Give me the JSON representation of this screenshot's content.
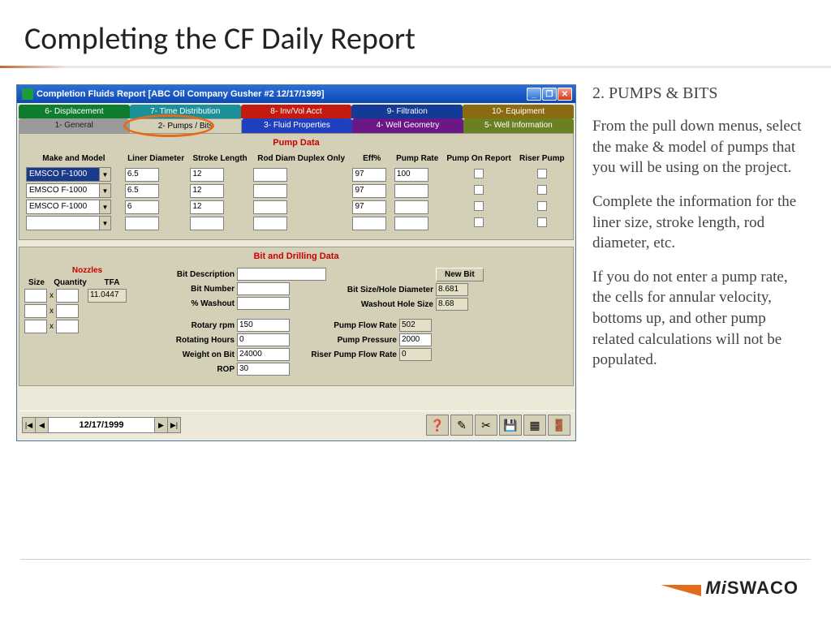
{
  "slide": {
    "title": "Completing the CF Daily Report"
  },
  "sidebar_text": {
    "heading": "2. PUMPS & BITS",
    "p1": "From the pull down menus, select the make & model of pumps that you will be using on the project.",
    "p2": "Complete the information for the liner size, stroke length, rod diameter, etc.",
    "p3": "If you do not enter a pump rate, the cells for annular velocity, bottoms up, and other pump related calculations will not be populated."
  },
  "window": {
    "title": "Completion Fluids Report [ABC Oil Company  Gusher #2  12/17/1999]",
    "tabs_top": [
      "6- Displacement",
      "7- Time Distribution",
      "8- Inv/Vol Acct",
      "9- Filtration",
      "10- Equipment"
    ],
    "tabs_bottom": [
      "1- General",
      "2- Pumps / Bits",
      "3- Fluid Properties",
      "4- Well Geometry",
      "5- Well Information"
    ],
    "active_tab": "2- Pumps / Bits",
    "pump_section_title": "Pump Data",
    "pump_headers": {
      "make": "Make and Model",
      "liner": "Liner Diameter",
      "stroke": "Stroke Length",
      "rod": "Rod Diam Duplex Only",
      "eff": "Eff%",
      "rate": "Pump Rate",
      "onreport": "Pump On Report",
      "riser": "Riser Pump"
    },
    "pump_rows": [
      {
        "make": "EMSCO F-1000",
        "liner": "6.5",
        "stroke": "12",
        "rod": "",
        "eff": "97",
        "rate": "100"
      },
      {
        "make": "EMSCO F-1000",
        "liner": "6.5",
        "stroke": "12",
        "rod": "",
        "eff": "97",
        "rate": ""
      },
      {
        "make": "EMSCO F-1000",
        "liner": "6",
        "stroke": "12",
        "rod": "",
        "eff": "97",
        "rate": ""
      },
      {
        "make": "",
        "liner": "",
        "stroke": "",
        "rod": "",
        "eff": "",
        "rate": ""
      }
    ],
    "bit_section_title": "Bit and Drilling Data",
    "nozzles": {
      "title": "Nozzles",
      "h_size": "Size",
      "h_qty": "Quantity",
      "h_tfa": "TFA",
      "tfa_value": "11.0447"
    },
    "bit_labels": {
      "desc": "Bit Description",
      "num": "Bit Number",
      "washout": "% Washout",
      "rpm": "Rotary rpm",
      "hours": "Rotating Hours",
      "wob": "Weight on Bit",
      "rop": "ROP",
      "hole_diam": "Bit Size/Hole Diameter",
      "wash_size": "Washout Hole Size",
      "flow": "Pump Flow Rate",
      "pressure": "Pump Pressure",
      "riser_flow": "Riser Pump Flow Rate"
    },
    "bit_values": {
      "desc": "",
      "num": "",
      "washout": "",
      "rpm": "150",
      "hours": "0",
      "wob": "24000",
      "rop": "30",
      "hole_diam": "8.681",
      "wash_size": "8.68",
      "flow": "502",
      "pressure": "2000",
      "riser_flow": "0"
    },
    "new_bit_btn": "New Bit",
    "footer_date": "12/17/1999"
  },
  "logo": {
    "mi": "Mi",
    "swaco": "SWACO"
  }
}
